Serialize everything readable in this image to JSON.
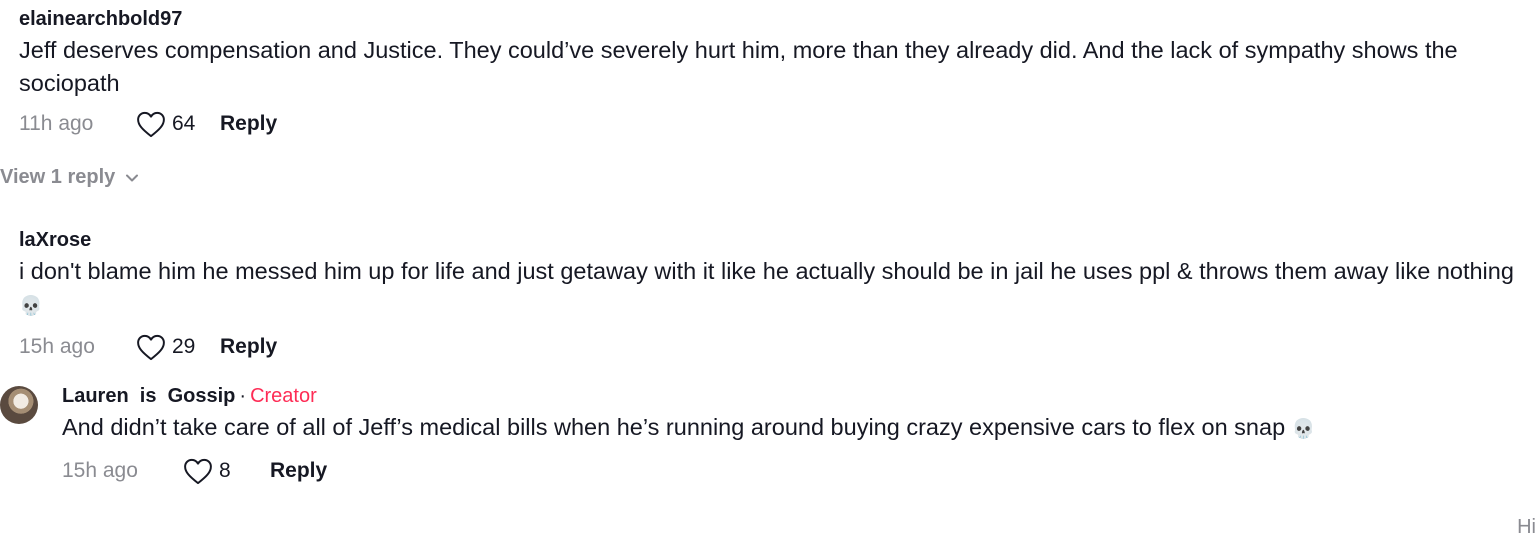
{
  "comments": [
    {
      "username": "elainearchbold97",
      "text": "Jeff deserves compensation and Justice. They could’ve severely hurt him, more than they already did. And the lack of sympathy shows the sociopath",
      "time": "11h ago",
      "likes": "64",
      "reply_label": "Reply",
      "view_replies_label": "View 1 reply"
    },
    {
      "username": "laXrose",
      "text": "i don't blame him he messed him up for life and just getaway with it like he actually should be in jail he uses ppl & throws them away like nothing",
      "emoji": "💀",
      "time": "15h ago",
      "likes": "29",
      "reply_label": "Reply"
    }
  ],
  "reply": {
    "username": "Lauren  is  Gossip",
    "separator": "·",
    "badge": "Creator",
    "text": "And didn’t take care of all of Jeff’s medical bills when he’s running around buying crazy expensive cars to flex on snap",
    "emoji": "💀",
    "time": "15h ago",
    "likes": "8",
    "reply_label": "Reply"
  },
  "corner_text": "Hi",
  "icons": {
    "like": "heart-outline-icon",
    "expand": "chevron-down-icon",
    "emoji": "skull-emoji"
  },
  "colors": {
    "text": "#161823",
    "muted": "#8a8b91",
    "creator": "#fe2c55"
  }
}
